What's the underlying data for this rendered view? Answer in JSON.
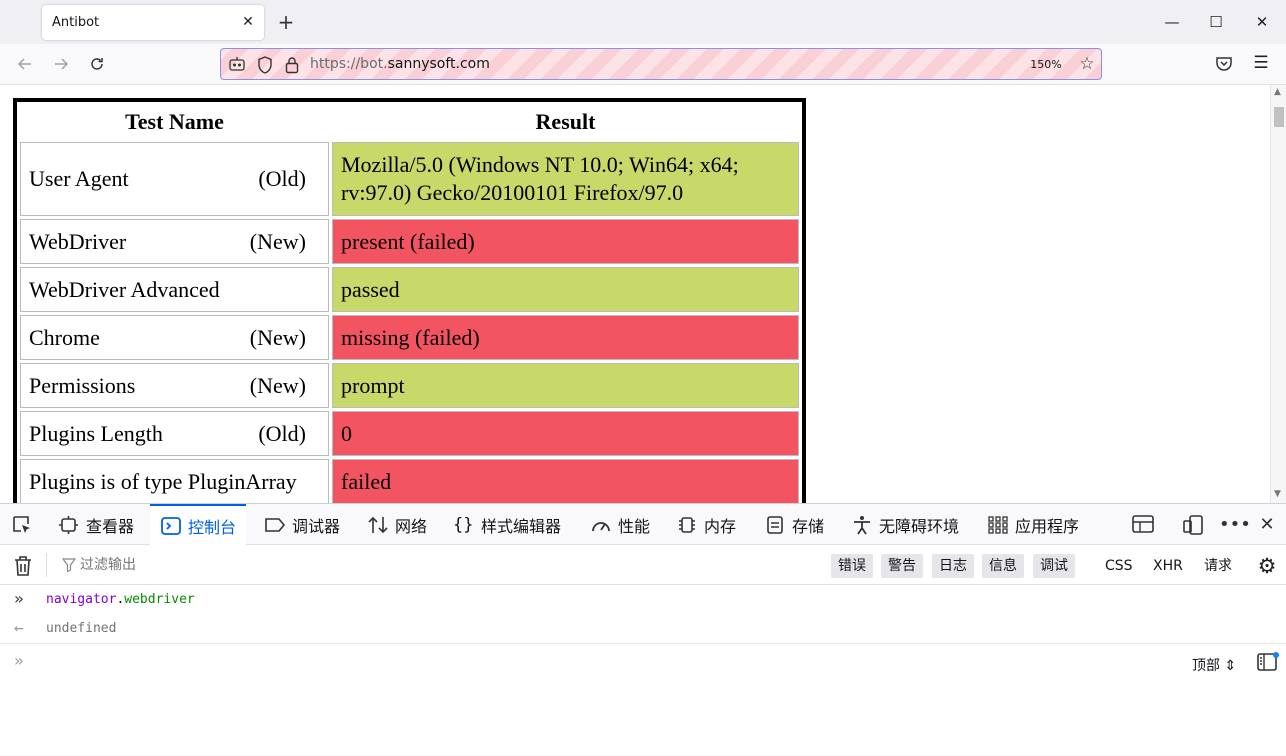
{
  "browser": {
    "tab_title": "Antibot",
    "tab_close": "✕",
    "new_tab": "+",
    "url_prefix": "https://bot.",
    "url_domain": "sannysoft.com",
    "zoom": "150%",
    "window_controls": {
      "minimize": "—",
      "maximize": "☐",
      "close": "✕"
    }
  },
  "page": {
    "headers": {
      "name": "Test Name",
      "result": "Result"
    },
    "rows": [
      {
        "name": "User Agent",
        "tag": "(Old)",
        "result": "Mozilla/5.0 (Windows NT 10.0; Win64; x64; rv:97.0) Gecko/20100101 Firefox/97.0",
        "status": "pass"
      },
      {
        "name": "WebDriver",
        "tag": "(New)",
        "result": "present (failed)",
        "status": "fail"
      },
      {
        "name": "WebDriver Advanced",
        "tag": "",
        "result": "passed",
        "status": "pass"
      },
      {
        "name": "Chrome",
        "tag": "(New)",
        "result": "missing (failed)",
        "status": "fail"
      },
      {
        "name": "Permissions",
        "tag": "(New)",
        "result": "prompt",
        "status": "pass"
      },
      {
        "name": "Plugins Length",
        "tag": "(Old)",
        "result": "0",
        "status": "fail"
      },
      {
        "name": "Plugins is of type PluginArray",
        "tag": "",
        "result": "failed",
        "status": "fail"
      }
    ],
    "colors": {
      "pass": "#c8d96a",
      "fail": "#f25561"
    }
  },
  "devtools": {
    "tabs": {
      "inspector": "查看器",
      "console": "控制台",
      "debugger": "调试器",
      "network": "网络",
      "style_editor": "样式编辑器",
      "performance": "性能",
      "memory": "内存",
      "storage": "存储",
      "accessibility": "无障碍环境",
      "application": "应用程序"
    },
    "filter_placeholder": "过滤输出",
    "levels": {
      "errors": "错误",
      "warnings": "警告",
      "logs": "日志",
      "info": "信息",
      "debug": "调试"
    },
    "net_filters": {
      "css": "CSS",
      "xhr": "XHR",
      "requests": "请求"
    },
    "console": {
      "input_obj": "navigator",
      "input_dot": ".",
      "input_prop": "webdriver",
      "output": "undefined"
    },
    "context_selector": "顶部 ⇕",
    "accent_color": "#0061e0"
  }
}
